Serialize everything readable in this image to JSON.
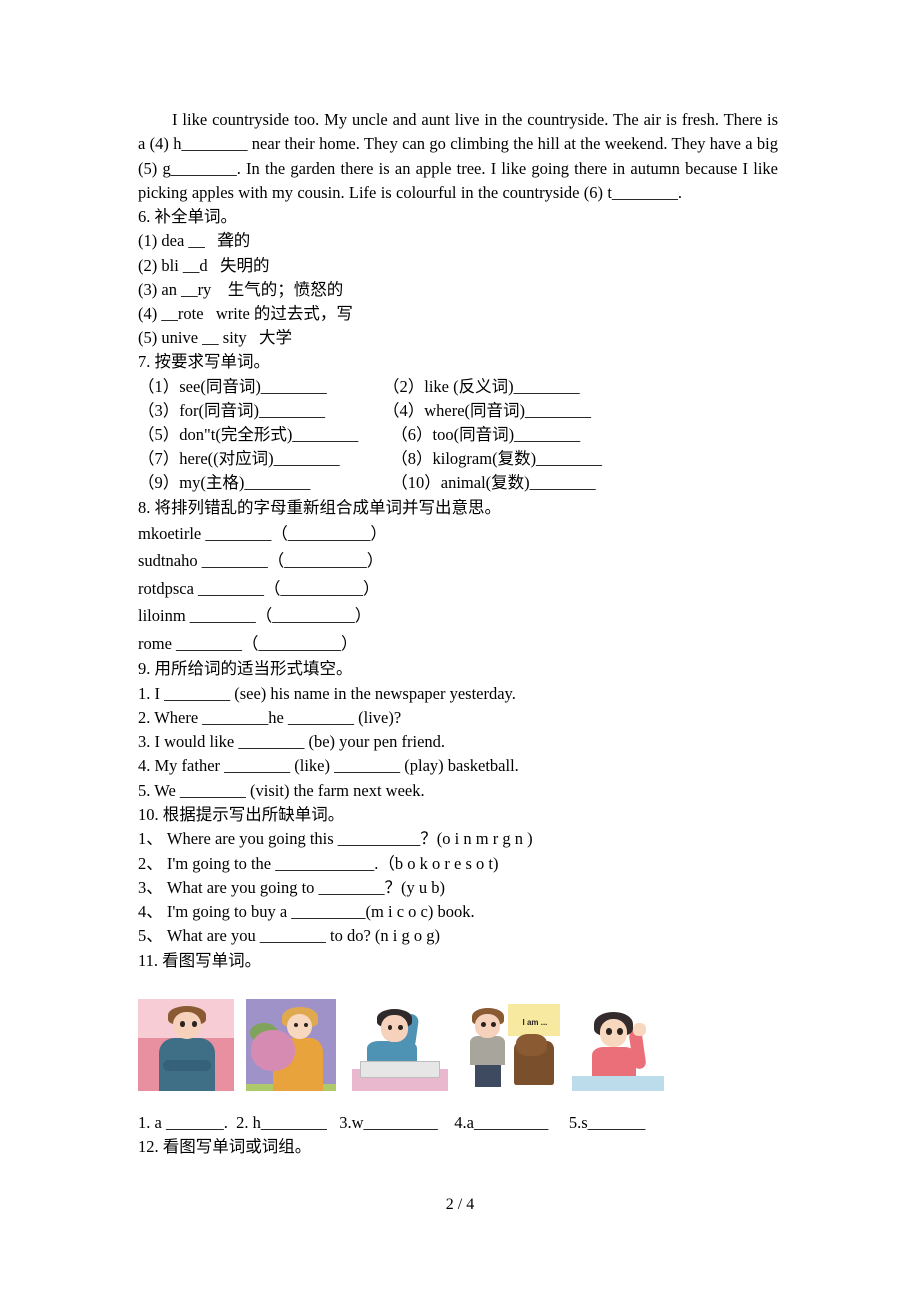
{
  "document": {
    "page_footer": "2 / 4"
  },
  "passage": {
    "text": "I like countryside too.  My uncle and aunt live in the countryside. The air is fresh. There is a (4) h________ near their home. They can go climbing the hill at the weekend. They have a big (5) g________. In the garden there is an apple tree. I like going there in autumn because I like picking apples with my cousin. Life is colourful in the countryside (6) t________."
  },
  "exercise6": {
    "title": "6. 补全单词。",
    "items": [
      "(1) dea __   聋的",
      "(2) bli __d   失明的",
      "(3) an __ry    生气的；愤怒的",
      "(4) __rote   write 的过去式，写",
      "(5) unive __ sity   大学"
    ]
  },
  "exercise7": {
    "title": "7. 按要求写单词。",
    "rows": [
      {
        "left": "（1）see(同音词)________",
        "right": "（2）like (反义词)________"
      },
      {
        "left": "（3）for(同音词)________",
        "right": "（4）where(同音词)________"
      },
      {
        "left": "（5）don\"t(完全形式)________",
        "right": "  （6）too(同音词)________"
      },
      {
        "left": "（7）here((对应词)________",
        "right": "  （8）kilogram(复数)________"
      },
      {
        "left": "（9）my(主格)________",
        "right": "  （10）animal(复数)________"
      }
    ]
  },
  "exercise8": {
    "title": "8. 将排列错乱的字母重新组合成单词并写出意思。",
    "items": [
      "mkoetirle ________（__________）",
      "sudtnaho ________（__________）",
      "rotdpsca ________（__________）",
      "liloinm ________（__________）",
      "rome ________（__________）"
    ]
  },
  "exercise9": {
    "title": "9. 用所给词的适当形式填空。",
    "items": [
      "1. I ________ (see) his name in the newspaper yesterday.",
      "2. Where ________he ________ (live)?",
      "3. I would like ________ (be) your pen friend.",
      "4. My father ________ (like) ________ (play) basketball.",
      "5. We ________ (visit) the farm next week."
    ]
  },
  "exercise10": {
    "title": "10. 根据提示写出所缺单词。",
    "items": [
      "1、 Where are you going this __________？(o i n m r g n )",
      "2、 I'm going to the ____________.（b o k o r e s o t)",
      "3、 What are you going to ________？(y u b)",
      "4、 I'm going to buy a _________(m i c o c) book.",
      "5、 What are you ________ to do? (n i g o g)"
    ]
  },
  "exercise11": {
    "title": "11. 看图写单词。",
    "pictures": [
      {
        "alt": "boy-arms-crossed-pink-background",
        "bubble": ""
      },
      {
        "alt": "woman-holding-flowers-purple-background",
        "bubble": ""
      },
      {
        "alt": "boy-scratching-head-at-desk",
        "bubble": ""
      },
      {
        "alt": "boy-afraid-of-dog",
        "bubble": "I am ..."
      },
      {
        "alt": "girl-raising-hand",
        "bubble": ""
      }
    ],
    "answers": "1. a _______.  2. h________   3.w_________    4.a_________     5.s_______"
  },
  "exercise12": {
    "title": "12. 看图写单词或词组。"
  }
}
